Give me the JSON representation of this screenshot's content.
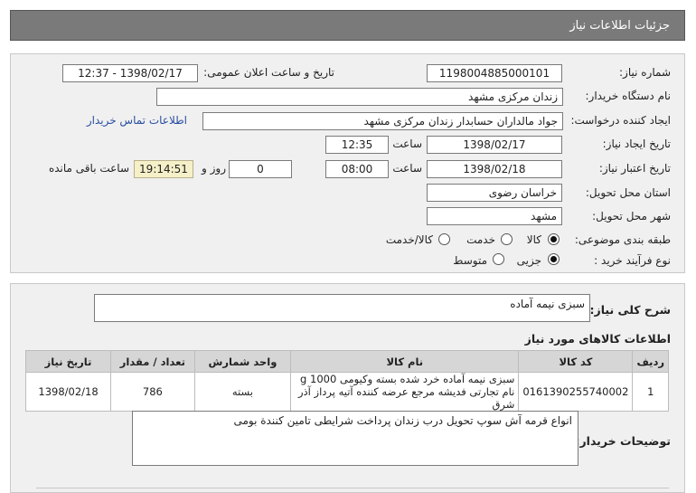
{
  "header": {
    "title": "جزئیات اطلاعات نیاز"
  },
  "form": {
    "need_number_label": "شماره نیاز:",
    "need_number": "1198004885000101",
    "announce_label": "تاریخ و ساعت اعلان عمومی:",
    "announce_value": "1398/02/17 - 12:37",
    "buyer_org_label": "نام دستگاه خریدار:",
    "buyer_org": "زندان مرکزی مشهد",
    "creator_label": "ایجاد کننده درخواست:",
    "creator": "جواد مالداران حسابدار زندان مرکزی مشهد",
    "contact_link": "اطلاعات تماس خریدار",
    "created_date_label": "تاریخ ایجاد نیاز:",
    "created_date": "1398/02/17",
    "time_label": "ساعت",
    "created_time": "12:35",
    "validity_label": "تاریخ اعتبار نیاز:",
    "validity_date": "1398/02/18",
    "validity_time": "08:00",
    "days_label": "روز و",
    "days_value": "0",
    "remaining_time": "19:14:51",
    "remaining_label": "ساعت باقی مانده",
    "province_label": "استان محل تحویل:",
    "province": "خراسان رضوی",
    "city_label": "شهر محل تحویل:",
    "city": "مشهد",
    "category_label": "طبقه بندی موضوعی:",
    "category_options": [
      "کالا",
      "خدمت",
      "کالا/خدمت"
    ],
    "process_label": "نوع فرآیند خرید :",
    "process_options": [
      "جزیی",
      "متوسط"
    ]
  },
  "summary": {
    "label": "شرح کلی نیاز:",
    "value": "سبزی نیمه آماده"
  },
  "items_section": {
    "title": "اطلاعات کالاهای مورد نیاز",
    "columns": [
      "ردیف",
      "کد کالا",
      "نام کالا",
      "واحد شمارش",
      "تعداد / مقدار",
      "تاریخ نیاز"
    ],
    "rows": [
      {
        "row": "1",
        "code": "0161390255740002",
        "name": "سبزی نیمه آماده خرد شده بسته وکیومی 1000 g نام تجارتی فدیشه مرجع عرضه کننده آتیه پرداز آذر شرق",
        "unit": "بسته",
        "qty": "786",
        "date": "1398/02/18"
      }
    ]
  },
  "buyer_notes": {
    "label": "توضیحات خریدار:",
    "value": "انواع قرمه آش سوپ تحویل درب زندان پرداخت شرایطی تامین کنندة بومی"
  }
}
